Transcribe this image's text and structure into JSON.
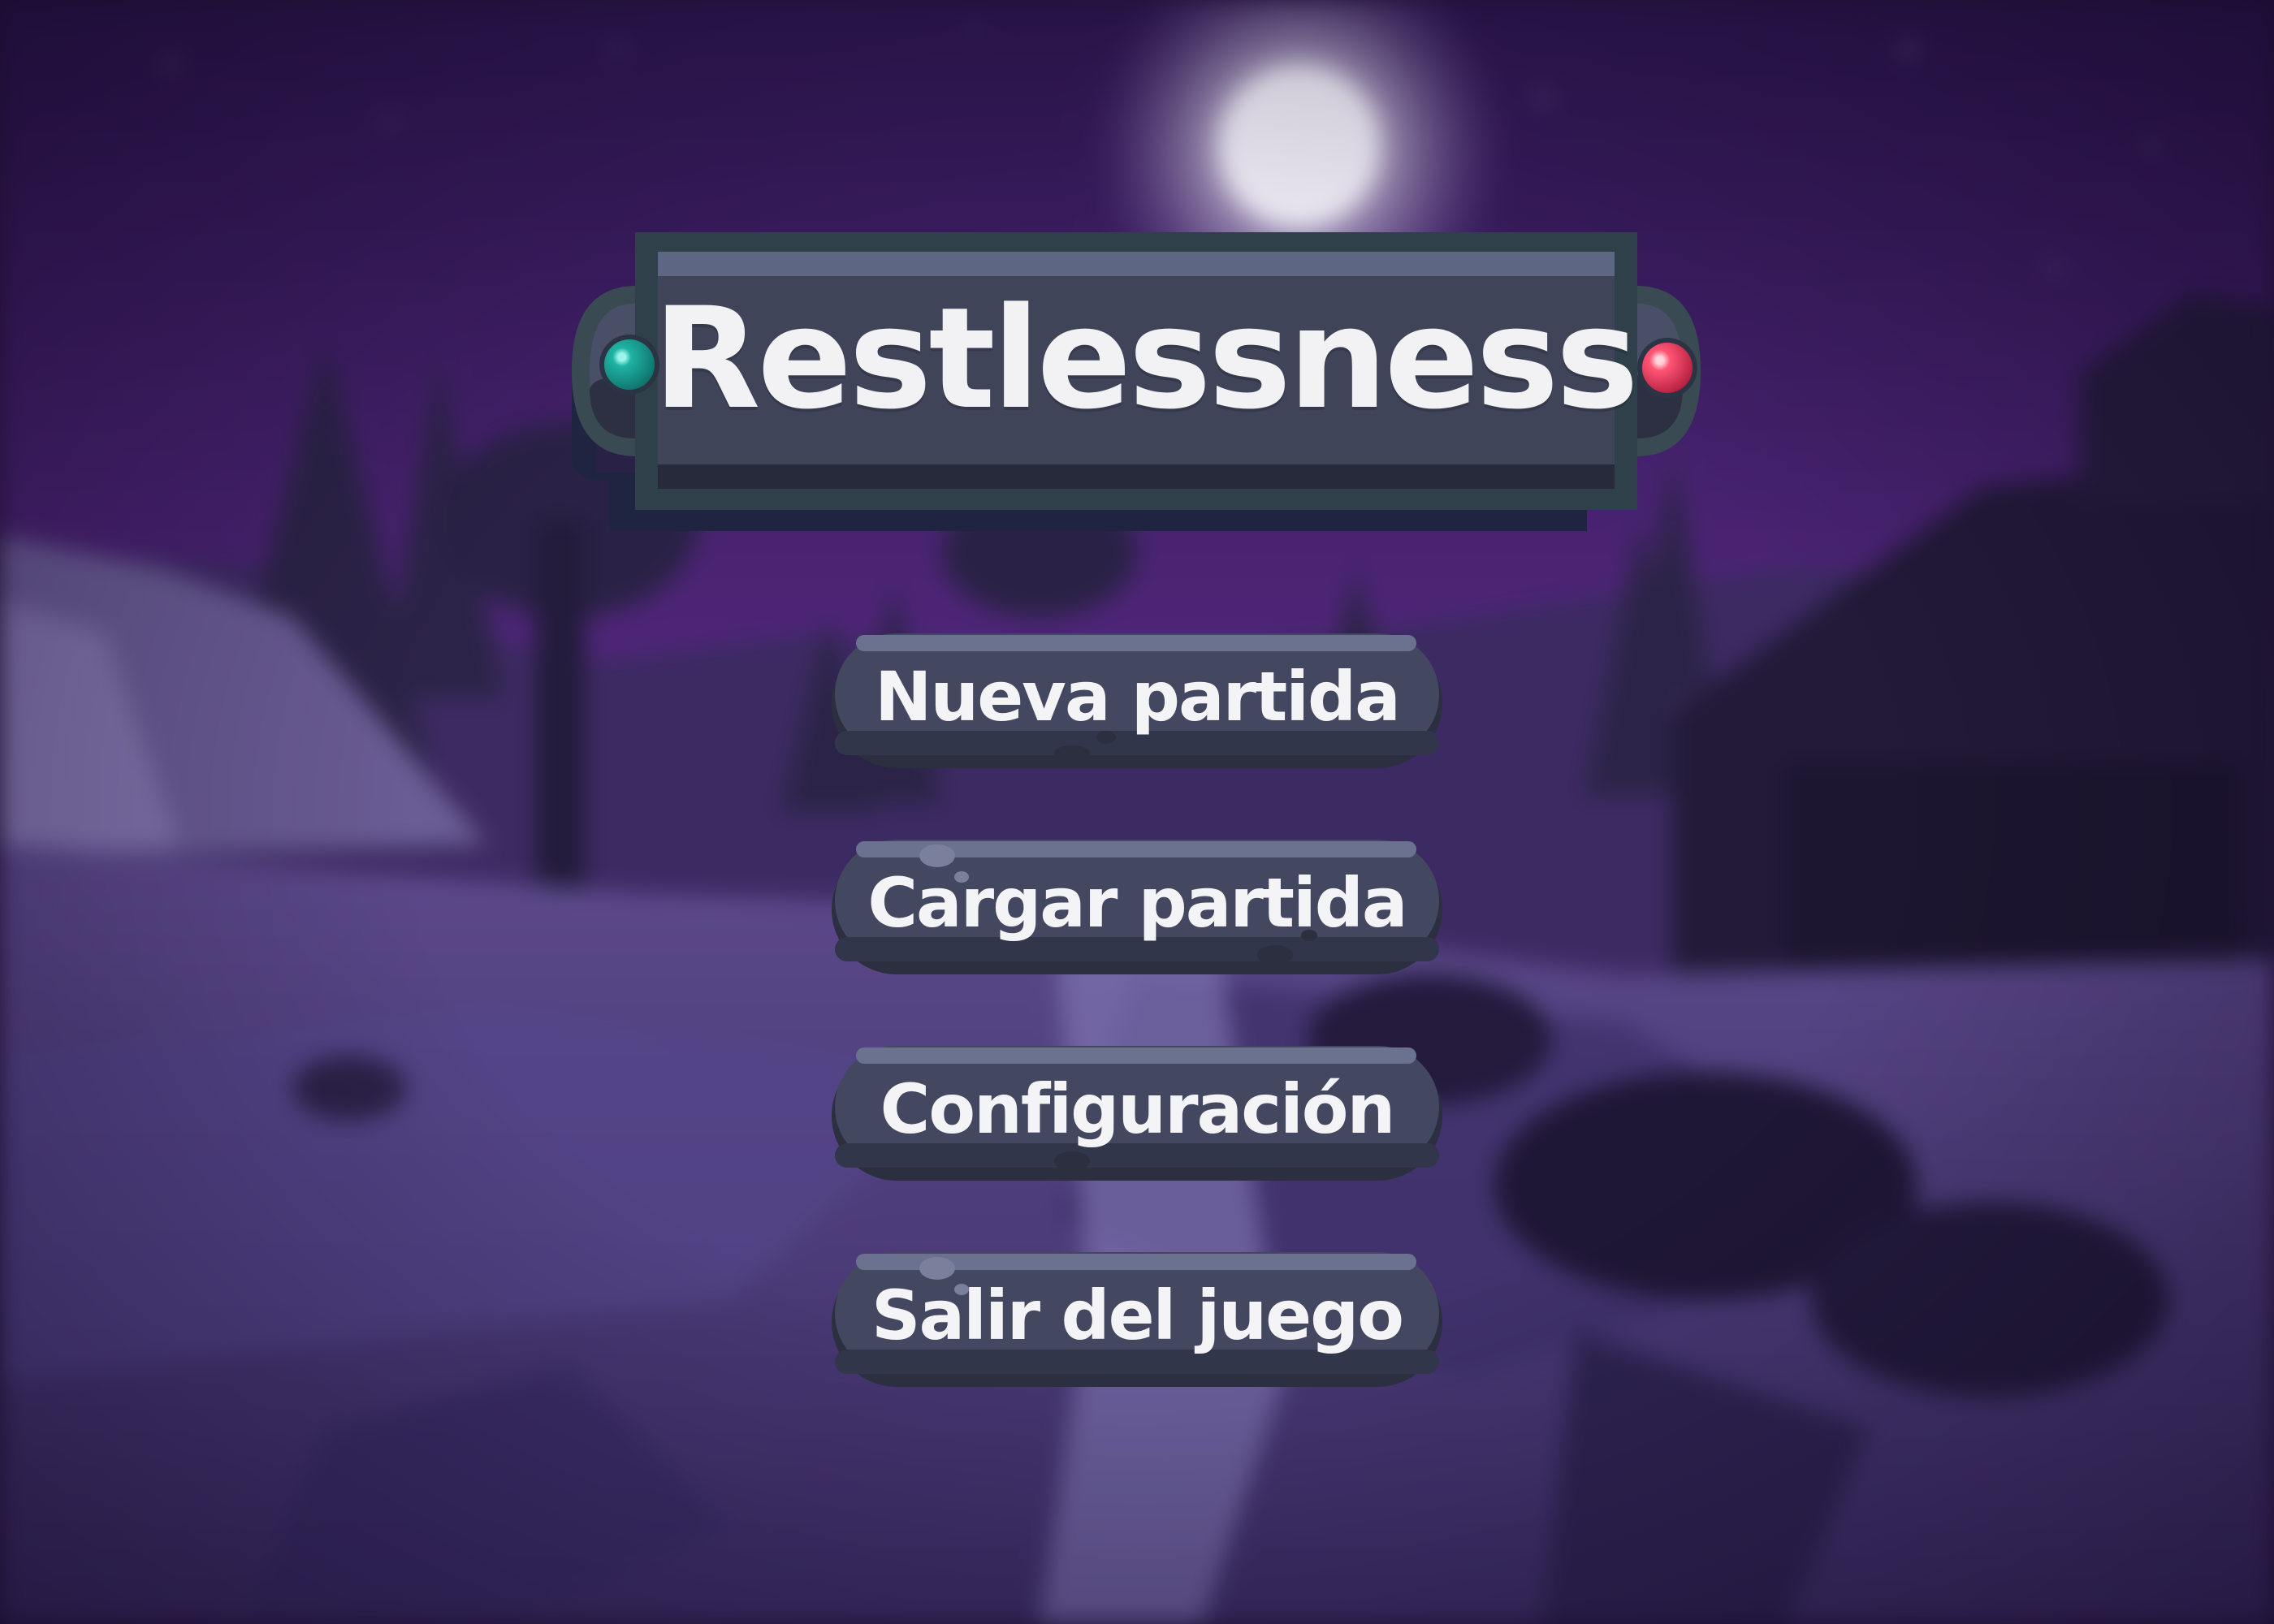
{
  "game": {
    "title": "Restlessness",
    "menu": [
      {
        "id": "new-game",
        "label": "Nueva partida"
      },
      {
        "id": "load-game",
        "label": "Cargar partida"
      },
      {
        "id": "settings",
        "label": "Configuración"
      },
      {
        "id": "quit",
        "label": "Salir del juego"
      }
    ]
  },
  "colors": {
    "panel": "#3e4358",
    "panel_dark": "#272b3a",
    "panel_border": "#2f3b48",
    "sky": "#4a2470",
    "gem_left": "#1fb3a4",
    "gem_right": "#ff5575"
  },
  "icons": {
    "gem_left": "teal-gem-icon",
    "gem_right": "red-gem-icon"
  }
}
